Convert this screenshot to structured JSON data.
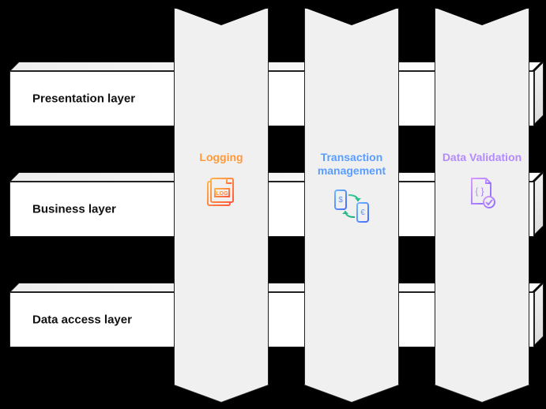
{
  "layers": [
    {
      "label": "Presentation layer"
    },
    {
      "label": "Business layer"
    },
    {
      "label": "Data access layer"
    }
  ],
  "pillars": [
    {
      "title": "Logging",
      "color": "#ff9a3c",
      "icon": "log-file-icon"
    },
    {
      "title": "Transaction management",
      "color": "#5a9dff",
      "icon": "transaction-exchange-icon"
    },
    {
      "title": "Data Validation",
      "color": "#b48bff",
      "icon": "data-validation-icon"
    }
  ]
}
